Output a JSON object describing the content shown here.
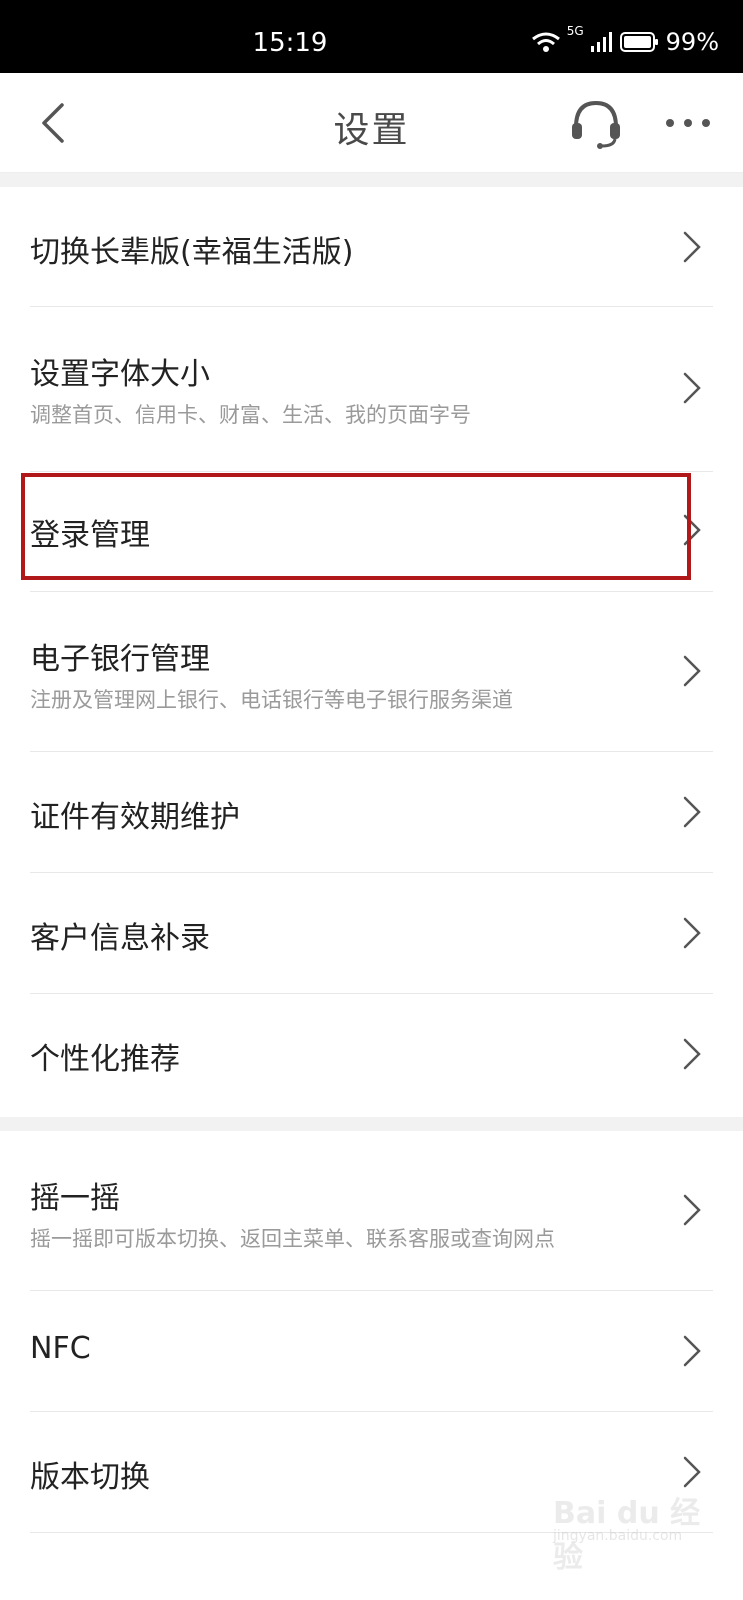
{
  "status_bar": {
    "time": "15:19",
    "network": "5G",
    "battery": "99%"
  },
  "nav": {
    "title": "设置"
  },
  "group1": [
    {
      "label": "切换长辈版(幸福生活版)",
      "sub": ""
    },
    {
      "label": "设置字体大小",
      "sub": "调整首页、信用卡、财富、生活、我的页面字号"
    },
    {
      "label": "登录管理",
      "sub": ""
    },
    {
      "label": "电子银行管理",
      "sub": "注册及管理网上银行、电话银行等电子银行服务渠道"
    },
    {
      "label": "证件有效期维护",
      "sub": ""
    },
    {
      "label": "客户信息补录",
      "sub": ""
    },
    {
      "label": "个性化推荐",
      "sub": ""
    }
  ],
  "group2": [
    {
      "label": "摇一摇",
      "sub": "摇一摇即可版本切换、返回主菜单、联系客服或查询网点"
    },
    {
      "label": "NFC",
      "sub": ""
    },
    {
      "label": "版本切换",
      "sub": ""
    }
  ],
  "watermark": {
    "main": "Bai du 经验",
    "sub": "jingyan.baidu.com"
  },
  "colors": {
    "highlight_border": "#b0181a",
    "section_gap": "#f2f2f2",
    "subtitle": "#9a9a9a"
  }
}
